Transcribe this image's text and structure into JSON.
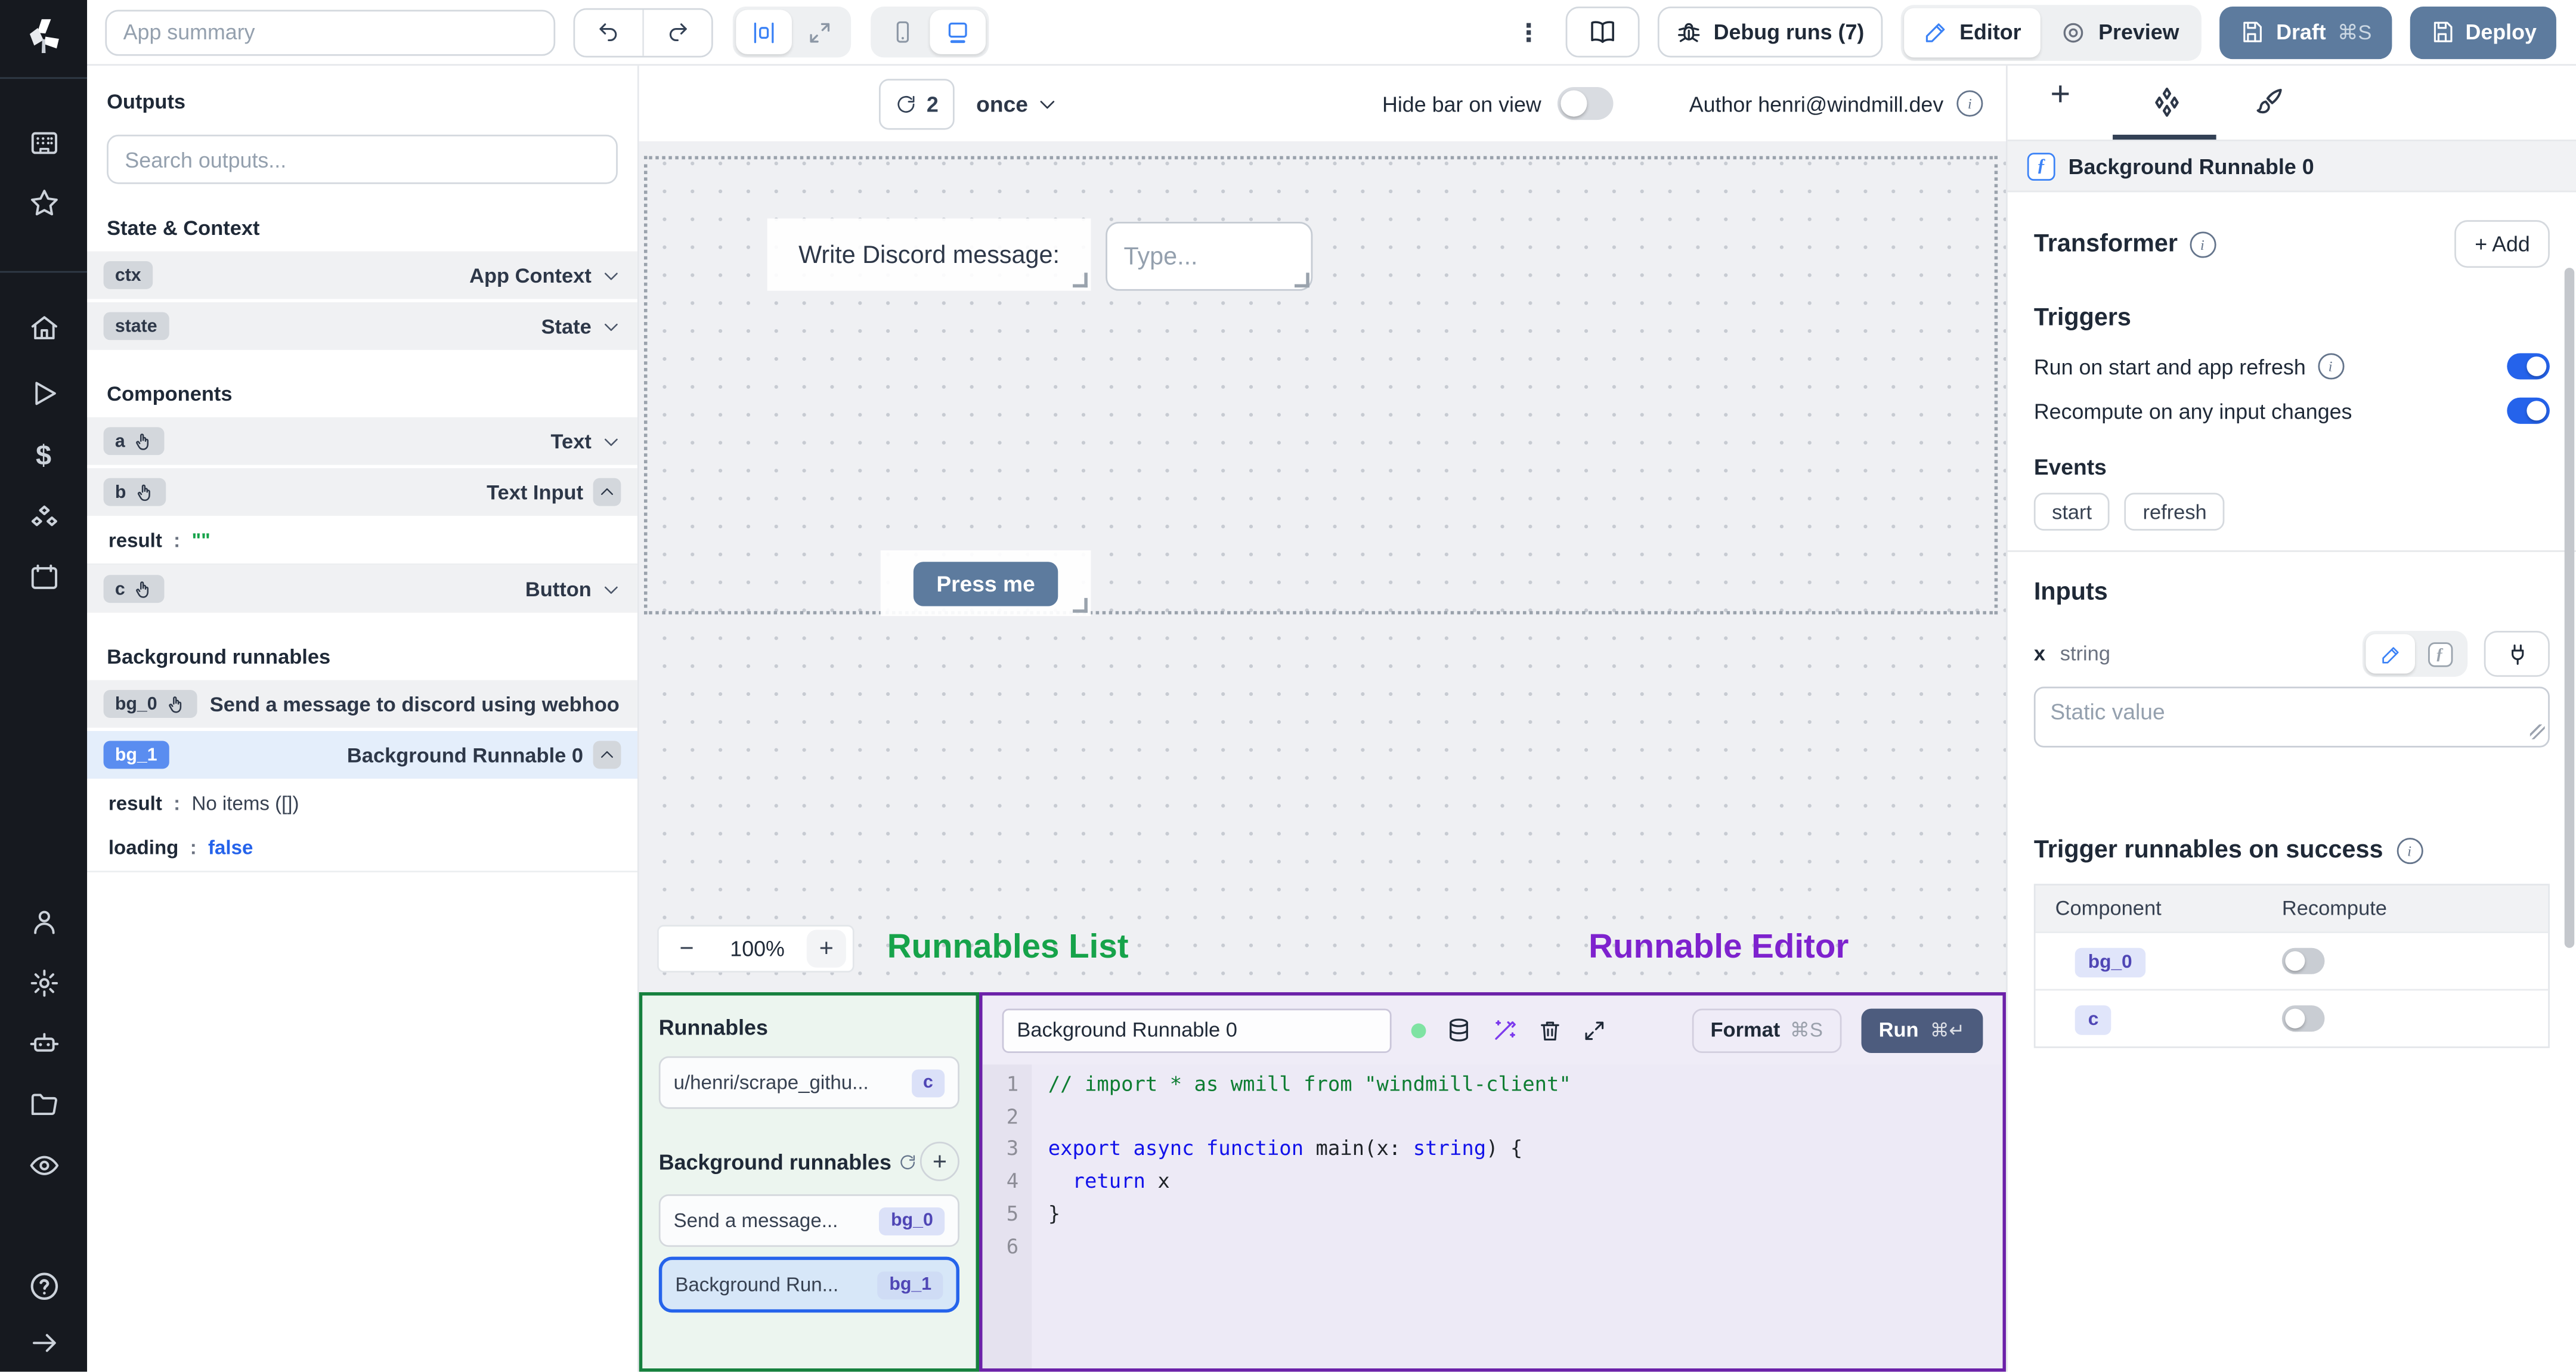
{
  "topbar": {
    "app_summary_placeholder": "App summary",
    "debug_runs_label": "Debug runs (7)",
    "editor_label": "Editor",
    "preview_label": "Preview",
    "draft_label": "Draft",
    "draft_shortcut": "⌘S",
    "deploy_label": "Deploy",
    "kebab": "⋮"
  },
  "outputs_panel": {
    "title": "Outputs",
    "search_placeholder": "Search outputs...",
    "state_context_heading": "State & Context",
    "ctx_badge": "ctx",
    "ctx_label": "App Context",
    "state_badge": "state",
    "state_label": "State",
    "components_heading": "Components",
    "a_badge": "a",
    "a_label": "Text",
    "b_badge": "b",
    "b_label": "Text Input",
    "b_result_key": "result",
    "colon": ":",
    "b_result_value": "\"\"",
    "c_badge": "c",
    "c_label": "Button",
    "bg_heading": "Background runnables",
    "bg0_badge": "bg_0",
    "bg0_label": "Send a message to discord using webhoo",
    "bg1_badge": "bg_1",
    "bg1_label": "Background Runnable 0",
    "bg1_result_key": "result",
    "bg1_result_value": "No items ([])",
    "bg1_loading_key": "loading",
    "bg1_loading_value": "false"
  },
  "canvas": {
    "refresh_count": "2",
    "interval_label": "once",
    "hide_bar_label": "Hide bar on view",
    "author_label": "Author henri@windmill.dev",
    "component_text": "Write Discord message:",
    "input_placeholder": "Type...",
    "button_label": "Press me",
    "zoom_out": "−",
    "zoom_level": "100%",
    "zoom_in": "+"
  },
  "annotations": {
    "runnables_list": "Runnables List",
    "runnable_editor": "Runnable Editor",
    "green_color": "#16a34a",
    "purple_color": "#7e22ce"
  },
  "runnables_panel": {
    "title": "Runnables",
    "item1_label": "u/henri/scrape_githu...",
    "item1_badge": "c",
    "bg_heading": "Background runnables",
    "add_label": "+",
    "item2_label": "Send a message...",
    "item2_badge": "bg_0",
    "item3_label": "Background Run...",
    "item3_badge": "bg_1"
  },
  "editor_panel": {
    "name_value": "Background Runnable 0",
    "format_label": "Format",
    "format_shortcut": "⌘S",
    "run_label": "Run",
    "run_shortcut": "⌘↵",
    "line_numbers": [
      "1",
      "2",
      "3",
      "4",
      "5",
      "6"
    ],
    "code": {
      "l1": "// import * as wmill from \"windmill-client\"",
      "l3_kw": "export async function ",
      "l3_name": "main",
      "l3_p1": "(x: ",
      "l3_type": "string",
      "l3_p2": ") {",
      "l4_kw": "  return",
      "l4_rest": " x",
      "l5": "}"
    }
  },
  "right_panel": {
    "header_icon": "ƒ",
    "header_title": "Background Runnable 0",
    "transformer_label": "Transformer",
    "add_label": "+ Add",
    "triggers_label": "Triggers",
    "run_on_start_label": "Run on start and app refresh",
    "recompute_label": "Recompute on any input changes",
    "events_label": "Events",
    "event_start": "start",
    "event_refresh": "refresh",
    "inputs_label": "Inputs",
    "input_name": "x",
    "input_type": "string",
    "static_placeholder": "Static value",
    "trigger_success_label": "Trigger runnables on success",
    "col_component": "Component",
    "col_recompute": "Recompute",
    "row1_badge": "bg_0",
    "row2_badge": "c"
  },
  "colors": {
    "accent_blue": "#2563eb",
    "slate_button": "#5d7b9e",
    "run_button": "#4d5c7e",
    "badge_blue": "#5a8df0",
    "selected_row": "#e4eefb"
  }
}
